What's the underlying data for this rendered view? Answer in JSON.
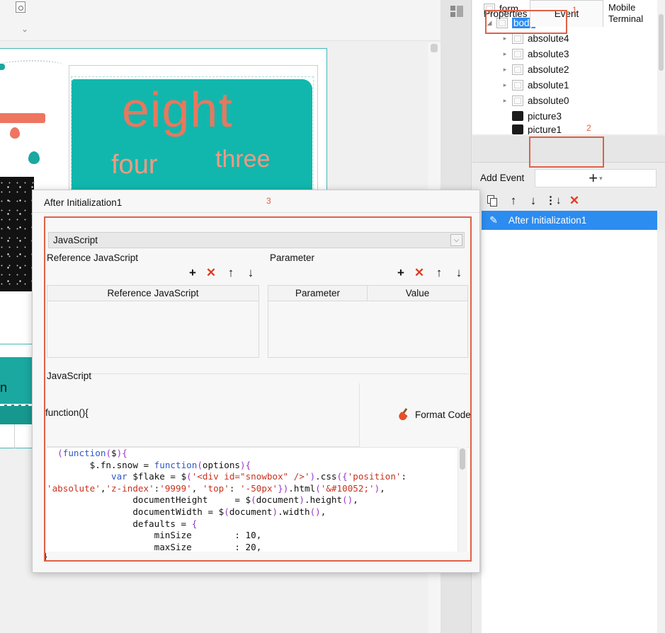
{
  "canvas": {
    "card_text_main": "eight",
    "card_text_left": "four",
    "card_text_right": "three",
    "table_col_letter": "n"
  },
  "tree": {
    "nodes": [
      {
        "label": "form"
      },
      {
        "label": "body"
      },
      {
        "label": "absolute4"
      },
      {
        "label": "absolute3"
      },
      {
        "label": "absolute2"
      },
      {
        "label": "absolute1"
      },
      {
        "label": "absolute0"
      },
      {
        "label": "picture3"
      },
      {
        "label": "picture1"
      }
    ]
  },
  "tabs": {
    "properties": "Properties",
    "event": "Event",
    "mobile_line1": "Mobile",
    "mobile_line2": "Terminal"
  },
  "events": {
    "add_label": "Add Event",
    "add_symbol": "+",
    "items": [
      {
        "label": "After Initialization1"
      }
    ]
  },
  "annotations": {
    "one": "1",
    "two": "2",
    "three": "3"
  },
  "dialog": {
    "title": "After Initialization1",
    "language": "JavaScript",
    "reference_section": "Reference JavaScript",
    "reference_column": "Reference JavaScript",
    "parameter_section": "Parameter",
    "parameter_columns": [
      "Parameter",
      "Value"
    ],
    "js_section": "JavaScript",
    "function_header": "function(){",
    "format_code": "Format Code",
    "function_footer": "}",
    "code_lines": [
      "  (function($){",
      "        $.fn.snow = function(options){",
      "            var $flake = $('<div id=\"snowbox\" />').css({'position':",
      "'absolute','z-index':'9999', 'top': '-50px'}).html('&#10052;'),",
      "                documentHeight     = $(document).height(),",
      "                documentWidth = $(document).width(),",
      "                defaults = {",
      "                    minSize        : 10,",
      "                    maxSize        : 20,"
    ]
  },
  "colors": {
    "accent": "#2d8cf0",
    "annotation": "#e06045",
    "teal": "#11b7ad",
    "delete": "#e23b1f"
  }
}
